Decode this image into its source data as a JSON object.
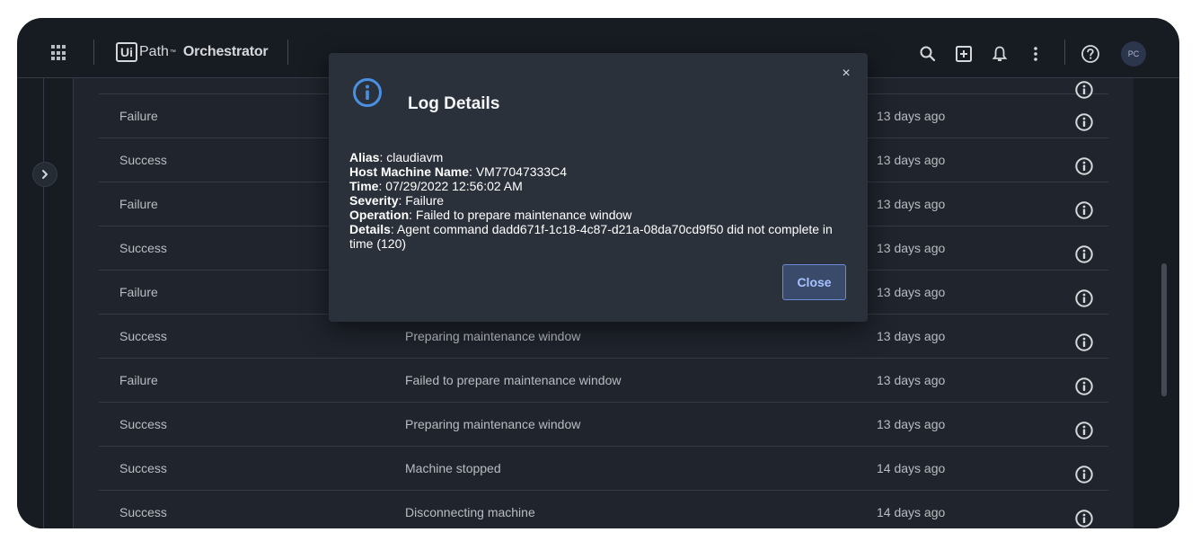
{
  "header": {
    "logo_box": "Ui",
    "logo_path": "Path",
    "logo_tm": "™",
    "product": "Orchestrator",
    "avatar": "PC"
  },
  "icons": {
    "apps": "apps-grid-icon",
    "search": "search-icon",
    "add": "add-box-icon",
    "notifications": "bell-icon",
    "more": "more-vertical-icon",
    "help": "help-circle-icon",
    "expand": "chevron-right-icon",
    "info": "info-circle-icon"
  },
  "table": {
    "rows": [
      {
        "status": "Failure",
        "message": "",
        "time": "13 days ago"
      },
      {
        "status": "Success",
        "message": "",
        "time": "13 days ago"
      },
      {
        "status": "Failure",
        "message": "",
        "time": "13 days ago"
      },
      {
        "status": "Success",
        "message": "",
        "time": "13 days ago"
      },
      {
        "status": "Failure",
        "message": "",
        "time": "13 days ago"
      },
      {
        "status": "Success",
        "message": "Preparing maintenance window",
        "time": "13 days ago"
      },
      {
        "status": "Failure",
        "message": "Failed to prepare maintenance window",
        "time": "13 days ago"
      },
      {
        "status": "Success",
        "message": "Preparing maintenance window",
        "time": "13 days ago"
      },
      {
        "status": "Success",
        "message": "Machine stopped",
        "time": "14 days ago"
      },
      {
        "status": "Success",
        "message": "Disconnecting machine",
        "time": "14 days ago"
      }
    ]
  },
  "dialog": {
    "title": "Log Details",
    "close_icon": "×",
    "fields": [
      {
        "label": "Alias",
        "value": ": claudiavm"
      },
      {
        "label": "Host Machine Name",
        "value": ": VM77047333C4"
      },
      {
        "label": "Time",
        "value": ": 07/29/2022 12:56:02 AM"
      },
      {
        "label": "Severity",
        "value": ": Failure"
      },
      {
        "label": "Operation",
        "value": ": Failed to prepare maintenance window"
      },
      {
        "label": "Details",
        "value": ": Agent command dadd671f-1c18-4c87-d21a-08da70cd9f50 did not complete in time (120)"
      }
    ],
    "close_button": "Close"
  },
  "colors": {
    "background": "#1a1f27",
    "content": "#222831",
    "dialog": "#2b313b",
    "accent": "#4a90e2"
  }
}
